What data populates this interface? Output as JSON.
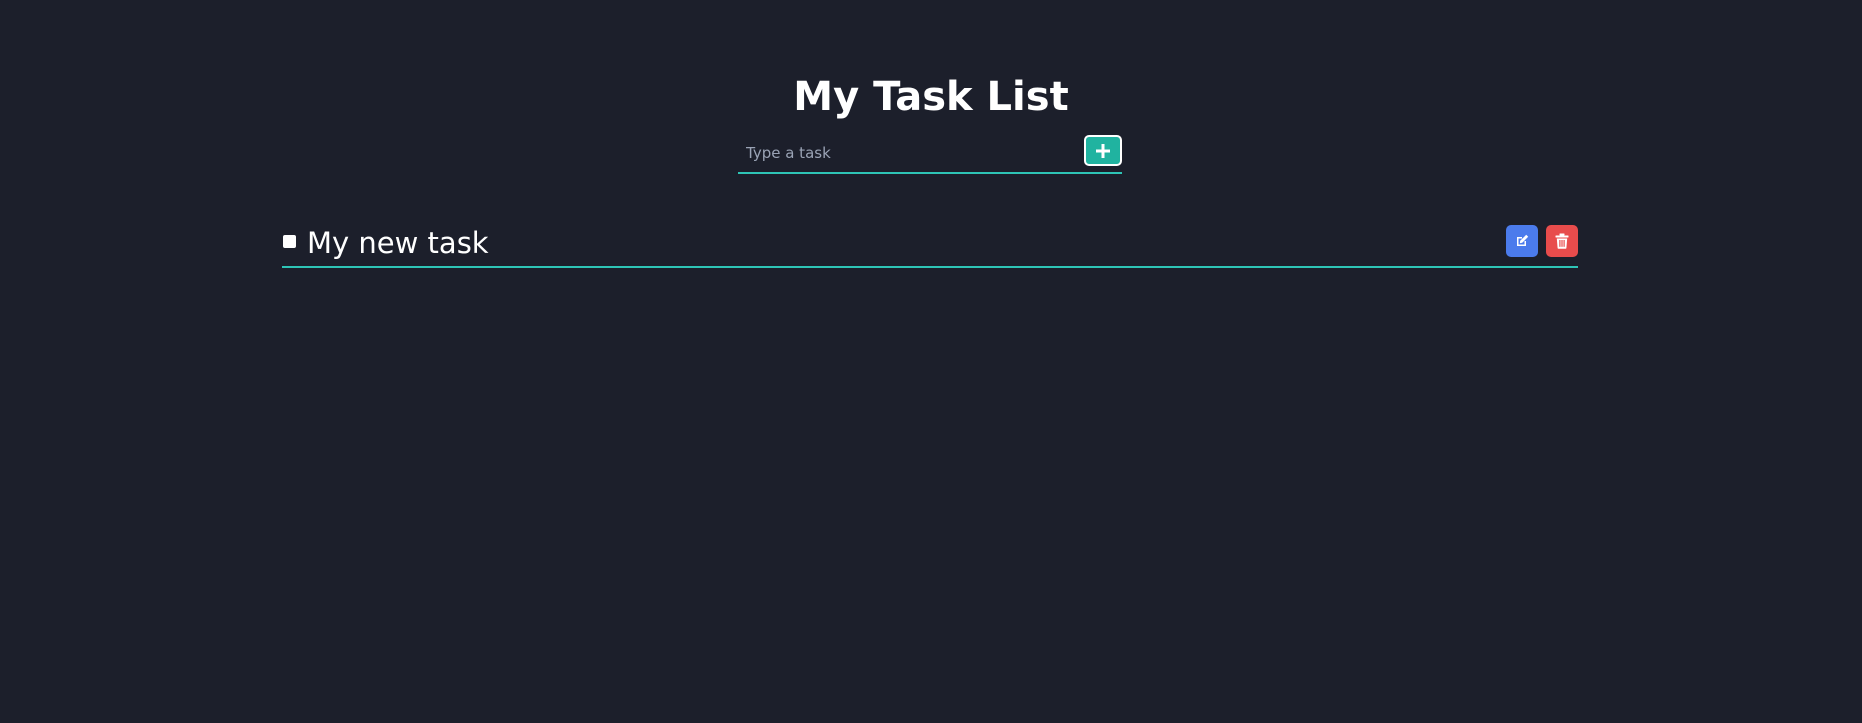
{
  "app": {
    "title": "My Task List"
  },
  "add_form": {
    "input_value": "",
    "placeholder": "Type a task",
    "add_icon": "plus-icon"
  },
  "tasks": [
    {
      "label": "My new task",
      "checked": false,
      "edit_icon": "edit-icon",
      "delete_icon": "trash-icon"
    }
  ],
  "colors": {
    "background": "#1c1f2b",
    "accent": "#2ec4b6",
    "add_button": "#20b3a0",
    "edit_button": "#4b7bec",
    "delete_button": "#e84c4c",
    "text": "#ffffff",
    "placeholder": "#9aa3b5"
  }
}
